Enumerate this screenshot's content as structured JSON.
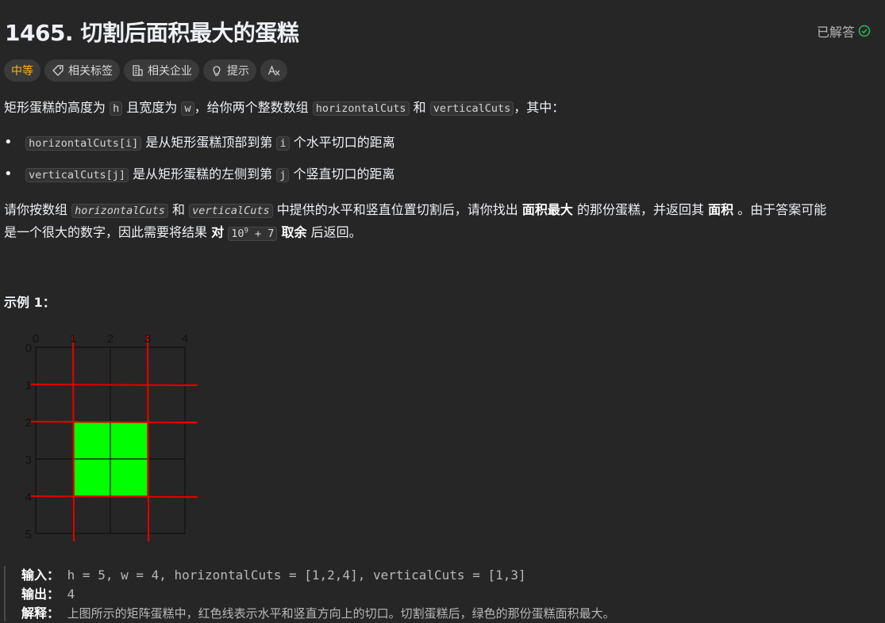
{
  "header": {
    "title": "1465. 切割后面积最大的蛋糕",
    "solved_label": "已解答",
    "solved_icon": "check-circle-icon"
  },
  "tags": [
    {
      "label": "中等",
      "icon": ""
    },
    {
      "label": "相关标签",
      "icon": "tag-icon"
    },
    {
      "label": "相关企业",
      "icon": "building-icon"
    },
    {
      "label": "提示",
      "icon": "lightbulb-icon"
    },
    {
      "label": "",
      "icon": "font-size-icon"
    }
  ],
  "description": {
    "p1_a": "矩形蛋糕的高度为",
    "h": "h",
    "p1_b": "且宽度为",
    "w": "w",
    "p1_c": "，给你两个整数数组",
    "horizontalCuts": "horizontalCuts",
    "p1_d": "和",
    "verticalCuts": "verticalCuts",
    "p1_e": "，其中：",
    "b1_code": "horizontalCuts[i]",
    "b1_a": "是从矩形蛋糕顶部到第",
    "b1_i": "i",
    "b1_b": "个水平切口的距离",
    "b2_code": "verticalCuts[j]",
    "b2_a": "是从矩形蛋糕的左侧到第",
    "b2_j": "j",
    "b2_b": "个竖直切口的距离",
    "p2_a": "请你按数组",
    "p2_and": "和",
    "p2_b": "中提供的水平和竖直位置切割后，请你找出",
    "p2_bold1": "面积最大",
    "p2_c": "的那份蛋糕，并返回其",
    "p2_bold2": "面积",
    "p2_d": "。由于答案可能",
    "p3_a": "是一个很大的数字，因此需要将结果",
    "p3_bold1": "对",
    "p3_mod_base": "10",
    "p3_mod_exp": "9",
    "p3_mod_rest": " + 7",
    "p3_bold2": "取余",
    "p3_b": "后返回。"
  },
  "example": {
    "title": "示例 1：",
    "figure": {
      "x_ticks": [
        "0",
        "1",
        "2",
        "3",
        "4"
      ],
      "y_ticks": [
        "0",
        "1",
        "2",
        "3",
        "4",
        "5"
      ],
      "cut_color": "#e00000",
      "highlight_color": "#00ff00"
    },
    "input_label": "输入：",
    "input_value": "h = 5, w = 4, horizontalCuts = [1,2,4], verticalCuts = [1,3]",
    "output_label": "输出：",
    "output_value": "4",
    "explain_label": "解释：",
    "explain_value": "上图所示的矩阵蛋糕中，红色线表示水平和竖直方向上的切口。切割蛋糕后，绿色的那份蛋糕面积最大。"
  }
}
